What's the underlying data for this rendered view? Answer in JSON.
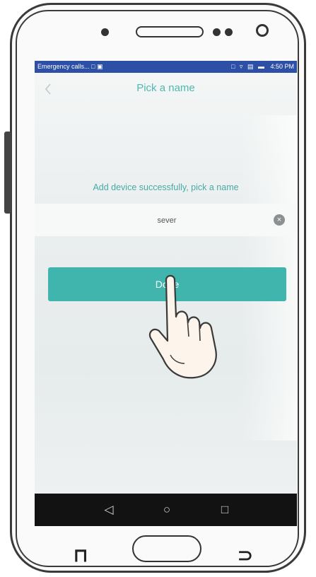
{
  "status_bar": {
    "notification_text": "Emergency calls...",
    "notification_icons": "□ ▣",
    "system_icons": "□ ▿ ▤ ▬",
    "time": "4:50 PM"
  },
  "app": {
    "back_icon": "chevron-left-icon",
    "title": "Pick a name",
    "prompt": "Add device successfully, pick a name",
    "name_field": {
      "value": "sever"
    },
    "done_button": {
      "label": "Done"
    }
  },
  "android_nav": {
    "back": "◁",
    "home": "○",
    "recents": "□"
  },
  "colors": {
    "accent": "#3fb5ad",
    "title_text": "#4fb8b1",
    "status_bar": "#2d4fa5"
  }
}
